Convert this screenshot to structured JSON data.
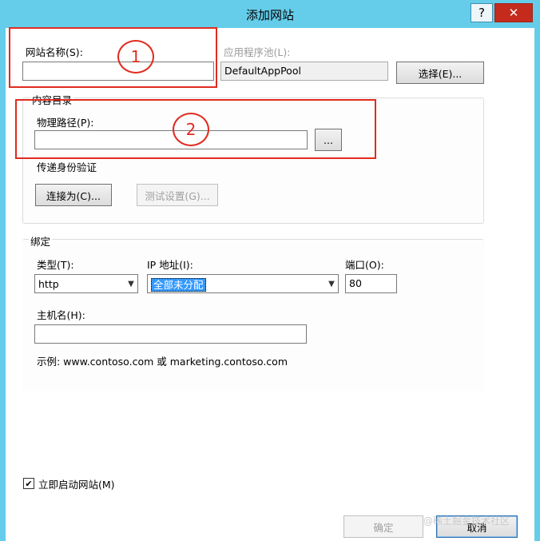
{
  "window": {
    "title": "添加网站",
    "help_glyph": "?",
    "close_glyph": "✕"
  },
  "site_name": {
    "label": "网站名称(S):",
    "value": ""
  },
  "app_pool": {
    "label": "应用程序池(L):",
    "value": "DefaultAppPool",
    "select_button": "选择(E)..."
  },
  "content_dir": {
    "group_label": "内容目录",
    "physical_path_label": "物理路径(P):",
    "physical_path_value": "",
    "browse_button": "...",
    "pass_through_label": "传递身份验证",
    "connect_as_button": "连接为(C)...",
    "test_settings_button": "测试设置(G)..."
  },
  "binding": {
    "group_label": "绑定",
    "type_label": "类型(T):",
    "type_value": "http",
    "ip_label": "IP 地址(I):",
    "ip_value": "全部未分配",
    "port_label": "端口(O):",
    "port_value": "80",
    "hostname_label": "主机名(H):",
    "hostname_value": "",
    "example_text": "示例: www.contoso.com 或 marketing.contoso.com"
  },
  "start_now": {
    "label": "立即启动网站(M)",
    "checked": true,
    "check_glyph": "✔"
  },
  "footer": {
    "ok_button": "确定",
    "cancel_button": "取消"
  },
  "annotations": {
    "marker_1": "1",
    "marker_2": "2"
  },
  "watermark": "@稀土掘金技术社区",
  "colors": {
    "titlebar": "#65cdea",
    "close": "#c42b1c",
    "annotation": "#e02b20",
    "selection": "#3399ff"
  }
}
